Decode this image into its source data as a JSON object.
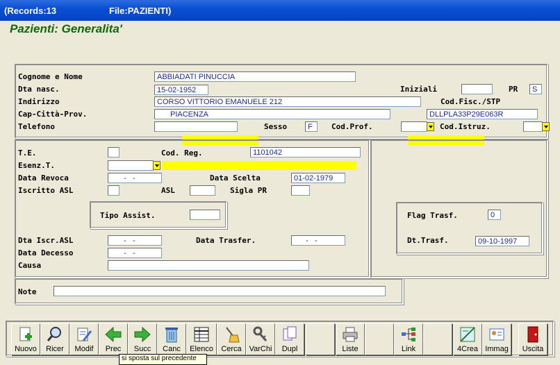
{
  "titlebar": {
    "records": "(Records:13",
    "file": "File:PAZIENTI)"
  },
  "heading": "Pazienti: Generalita'",
  "anagrafica": {
    "cognome_label": "Cognome e Nome",
    "cognome_value": "ABBIADATI PINUCCIA",
    "nasc_label": "Dta nasc.",
    "nasc_value": "15-02-1952",
    "iniziali_label": "Iniziali",
    "iniziali_value": "",
    "pr_label": "PR",
    "pr_value": "S",
    "indirizzo_label": "Indirizzo",
    "indirizzo_value": "CORSO VITTORIO EMANUELE 212",
    "codfisc_label": "Cod.Fisc./STP",
    "codfisc_value": "DLLPLA33P29E063R",
    "cap_label": "Cap-Città-Prov.",
    "cap_value": "PIACENZA",
    "telefono_label": "Telefono",
    "telefono_value": "",
    "sesso_label": "Sesso",
    "sesso_value": "F",
    "codprof_label": "Cod.Prof.",
    "codprof_value": "",
    "codistruz_label": "Cod.Istruz.",
    "codistruz_value": ""
  },
  "asl": {
    "te_label": "T.E.",
    "te_value": "",
    "codreg_label": "Cod. Reg.",
    "codreg_value": "1101042",
    "esenz_label": "Esenz.T.",
    "esenz_value": "",
    "revoca_label": "Data Revoca",
    "revoca_value": "  -   -",
    "scelta_label": "Data Scelta",
    "scelta_value": "01-02-1979",
    "iscritto_label": "Iscritto ASL",
    "iscritto_value": "",
    "asl_label": "ASL",
    "asl_value": "",
    "sigla_label": "Sigla PR",
    "sigla_value": "",
    "tipo_label": "Tipo Assist.",
    "tipo_value": "",
    "iscr_label": "Dta Iscr.ASL",
    "iscr_value": "  -   -",
    "trasfer_label": "Data Trasfer.",
    "trasfer_value": "  -   -",
    "decesso_label": "Data Decesso",
    "decesso_value": "  -   -",
    "causa_label": "Causa",
    "causa_value": ""
  },
  "trasf": {
    "flag_label": "Flag Trasf.",
    "flag_value": "0",
    "dt_label": "Dt.Trasf.",
    "dt_value": "09-10-1997"
  },
  "note": {
    "label": "Note",
    "value": ""
  },
  "toolbar": {
    "buttons": [
      {
        "label": "Nuovo",
        "icon": "add-document-icon"
      },
      {
        "label": "Ricer",
        "icon": "search-icon"
      },
      {
        "label": "Modif",
        "icon": "edit-document-icon"
      },
      {
        "label": "Prec",
        "icon": "arrow-left-icon"
      },
      {
        "label": "Succ",
        "icon": "arrow-right-icon"
      },
      {
        "label": "Canc",
        "icon": "trash-icon"
      },
      {
        "label": "Elenco",
        "icon": "list-icon"
      },
      {
        "label": "Cerca",
        "icon": "search-broom-icon"
      },
      {
        "label": "VarChi",
        "icon": "keys-icon"
      },
      {
        "label": "Dupl",
        "icon": "duplicate-icon"
      },
      {
        "label": "Liste",
        "icon": "printer-icon"
      },
      {
        "label": "Link",
        "icon": "link-tree-icon"
      },
      {
        "label": "4Crea",
        "icon": "create-icon"
      },
      {
        "label": "Immag",
        "icon": "image-card-icon"
      },
      {
        "label": "Uscita",
        "icon": "exit-door-icon"
      }
    ],
    "tooltip": "si sposta sul precedente"
  },
  "colors": {
    "title_green": "#0B6A0B",
    "value_blue": "#1D2A9A",
    "highlight": "#FFFF00"
  }
}
